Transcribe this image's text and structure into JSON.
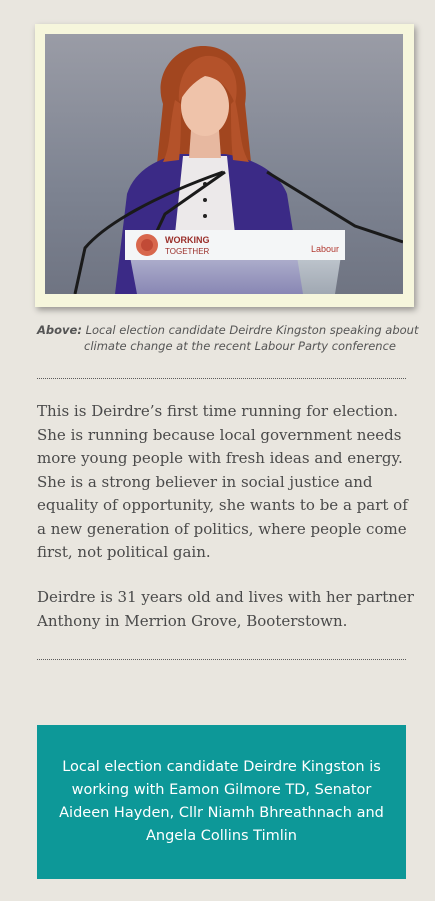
{
  "photo": {
    "podium_sign_line1": "WORKING",
    "podium_sign_line2": "TOGETHER",
    "podium_sign_brand": "Labour"
  },
  "caption": {
    "lead": "Above:",
    "line1": "Local election candidate Deirdre Kingston speaking about",
    "line2": "climate change at the recent Labour Party conference"
  },
  "paragraphs": [
    "This is Deirdre’s first time running for election. She is running because local government needs more young people with fresh ideas and energy. She is a strong believer in social justice and equality of opportunity, she wants to be a part of a new generation of politics, where people come first, not political gain.",
    "Deirdre is 31 years old and lives with her partner Anthony in Merrion Grove, Booterstown."
  ],
  "callout": {
    "text": "Local election candidate Deirdre Kingston is working with Eamon Gilmore TD, Senator Aideen Hayden, Cllr Niamh Bhreathnach and Angela Collins Timlin"
  },
  "colors": {
    "page_background": "#e9e6df",
    "photo_frame": "#f6f6dc",
    "callout_background": "#0d9898",
    "body_text": "#4a4a4a"
  }
}
